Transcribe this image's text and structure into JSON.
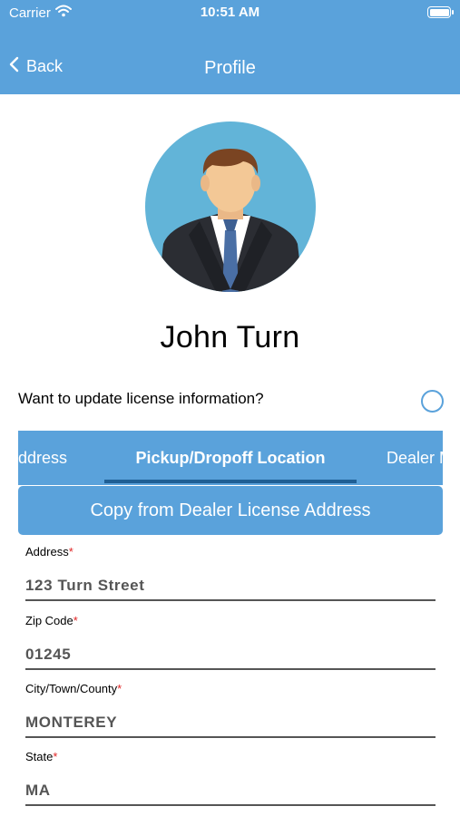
{
  "status_bar": {
    "carrier": "Carrier",
    "time": "10:51 AM"
  },
  "nav": {
    "back_label": "Back",
    "title": "Profile"
  },
  "profile": {
    "name": "John  Turn"
  },
  "update_license": {
    "label": "Want to update license information?"
  },
  "tabs": [
    {
      "label": "Address"
    },
    {
      "label": "Pickup/Dropoff Location"
    },
    {
      "label": "Dealer M"
    }
  ],
  "copy_button": {
    "label": "Copy from Dealer License Address"
  },
  "form": {
    "address": {
      "label": "Address",
      "required_mark": "*",
      "value": "123 Turn Street"
    },
    "zip": {
      "label": "Zip  Code",
      "required_mark": "*",
      "value": "01245"
    },
    "city": {
      "label": "City/Town/County",
      "required_mark": "*",
      "value": "MONTEREY"
    },
    "state": {
      "label": "State",
      "required_mark": "*",
      "value": "MA"
    }
  },
  "colors": {
    "primary": "#5aa2db",
    "active_tab_underline": "#1f5f95",
    "required": "#e02424"
  }
}
